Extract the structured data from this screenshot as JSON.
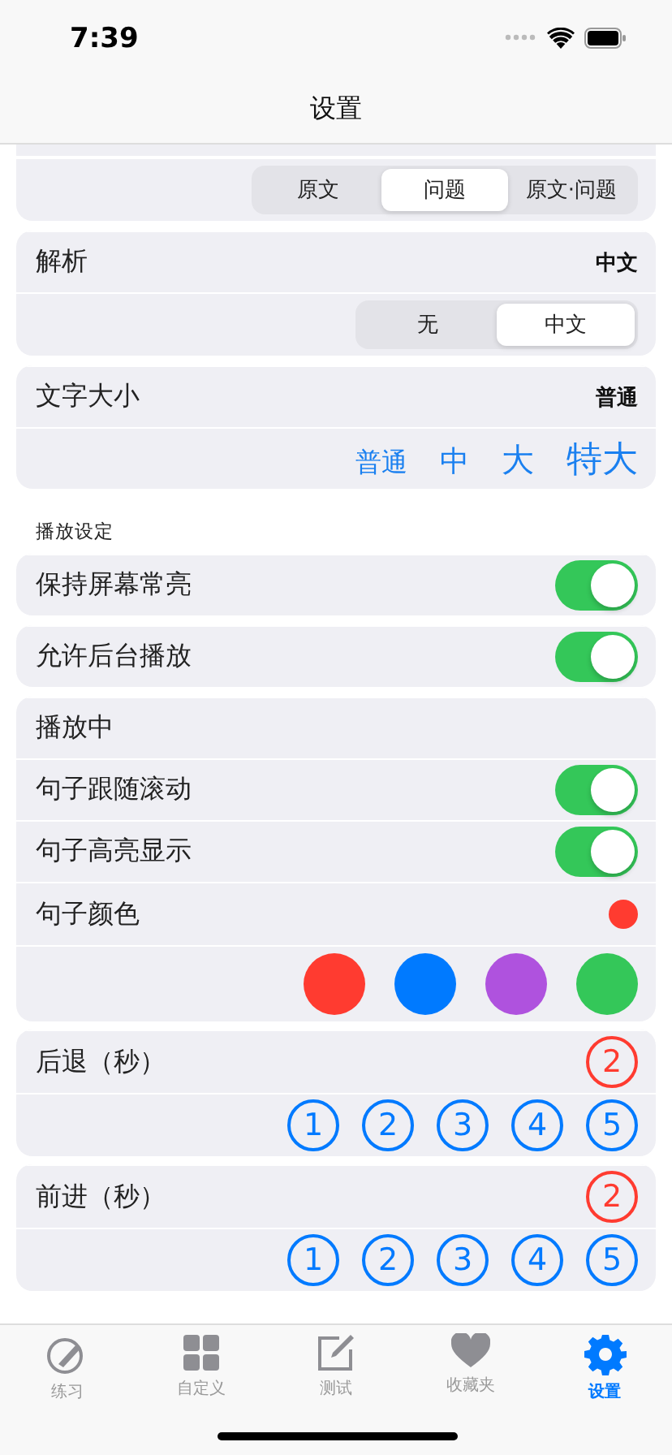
{
  "status_bar": {
    "time": "7:39"
  },
  "nav": {
    "title": "设置"
  },
  "sections": [
    {
      "cards": [
        {
          "clipped_top": true,
          "rows": [
            {
              "kind": "segmented",
              "options": [
                {
                  "label": "原文",
                  "selected": false
                },
                {
                  "label": "问题",
                  "selected": true
                },
                {
                  "label": "原文·问题",
                  "selected": false
                }
              ]
            }
          ]
        },
        {
          "rows": [
            {
              "kind": "value",
              "label": "解析",
              "value": "中文"
            },
            {
              "kind": "segmented",
              "options": [
                {
                  "label": "无",
                  "selected": false
                },
                {
                  "label": "中文",
                  "selected": true
                }
              ]
            }
          ]
        },
        {
          "rows": [
            {
              "kind": "value",
              "label": "文字大小",
              "value": "普通"
            },
            {
              "kind": "sizes",
              "options": [
                {
                  "label": "普通",
                  "kind": "normal"
                },
                {
                  "label": "中",
                  "kind": "medium"
                },
                {
                  "label": "大",
                  "kind": "large"
                },
                {
                  "label": "特大",
                  "kind": "xlarge"
                }
              ]
            }
          ]
        }
      ]
    },
    {
      "header": "播放设定",
      "cards": [
        {
          "rows": [
            {
              "kind": "toggle",
              "label": "保持屏幕常亮",
              "on": true
            }
          ]
        },
        {
          "rows": [
            {
              "kind": "toggle",
              "label": "允许后台播放",
              "on": true
            }
          ]
        },
        {
          "rows": [
            {
              "kind": "title",
              "label": "播放中"
            },
            {
              "kind": "toggle",
              "label": "句子跟随滚动",
              "on": true
            },
            {
              "kind": "toggle",
              "label": "句子高亮显示",
              "on": true
            },
            {
              "kind": "color",
              "label": "句子颜色",
              "color": "#ff3b30"
            },
            {
              "kind": "swatches",
              "options": [
                {
                  "color": "#ff3b30"
                },
                {
                  "color": "#007aff"
                },
                {
                  "color": "#af52de"
                },
                {
                  "color": "#34c759"
                }
              ]
            }
          ]
        },
        {
          "rows": [
            {
              "kind": "number",
              "label": "后退（秒）",
              "value": "2"
            },
            {
              "kind": "numbers",
              "options": [
                {
                  "label": "1"
                },
                {
                  "label": "2"
                },
                {
                  "label": "3"
                },
                {
                  "label": "4"
                },
                {
                  "label": "5"
                }
              ]
            }
          ]
        },
        {
          "rows": [
            {
              "kind": "number",
              "label": "前进（秒）",
              "value": "2"
            },
            {
              "kind": "numbers",
              "options": [
                {
                  "label": "1"
                },
                {
                  "label": "2"
                },
                {
                  "label": "3"
                },
                {
                  "label": "4"
                },
                {
                  "label": "5"
                }
              ]
            }
          ]
        }
      ]
    }
  ],
  "tab_bar": {
    "tabs": [
      {
        "label": "练习",
        "kind": "practice",
        "selected": false
      },
      {
        "label": "自定义",
        "kind": "grid",
        "selected": false
      },
      {
        "label": "测试",
        "kind": "compose",
        "selected": false
      },
      {
        "label": "收藏夹",
        "kind": "heart",
        "selected": false
      },
      {
        "label": "设置",
        "kind": "gear",
        "selected": true
      }
    ]
  }
}
